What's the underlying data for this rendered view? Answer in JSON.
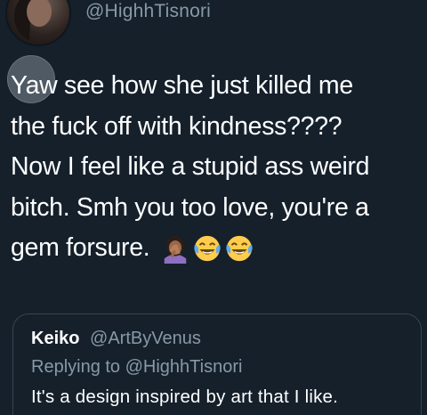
{
  "tweet": {
    "handle": "@HighhTisnori",
    "lines": [
      "Yaw see how she just killed me",
      "the fuck off with kindness????",
      "Now I feel like a stupid ass weird",
      "bitch. Smh you too love, you're a",
      "gem forsure."
    ],
    "emojis": [
      "woman-facepalming-icon",
      "face-with-tears-of-joy-icon",
      "face-with-tears-of-joy-icon"
    ]
  },
  "quoted_tweet": {
    "name": "Keiko",
    "handle": "@ArtByVenus",
    "replying_to": "Replying to @HighhTisnori",
    "text": "It's a design inspired by art that I like."
  },
  "colors": {
    "background": "#15202b",
    "secondary_text": "#8899a6",
    "primary_text": "#ffffff",
    "card_border": "#38444d"
  }
}
